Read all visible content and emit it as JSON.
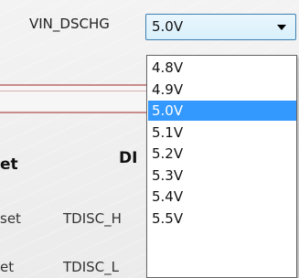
{
  "field": {
    "label": "VIN_DSCHG"
  },
  "select": {
    "value": "5.0V",
    "arrow_icon": "chevron-down-icon",
    "options": [
      "4.8V",
      "4.9V",
      "5.0V",
      "5.1V",
      "5.2V",
      "5.3V",
      "5.4V",
      "5.5V"
    ],
    "selected_index": 2
  },
  "background": {
    "frag_et": "et",
    "frag_di": "DI",
    "frag_set": "set",
    "frag_tdisc_h": "TDISC_H",
    "frag_et2": "et",
    "frag_tdisc_l": "TDISC_L"
  },
  "colors": {
    "selection": "#3399ff",
    "border": "#3c7fb1",
    "band": "#c98b8b"
  }
}
